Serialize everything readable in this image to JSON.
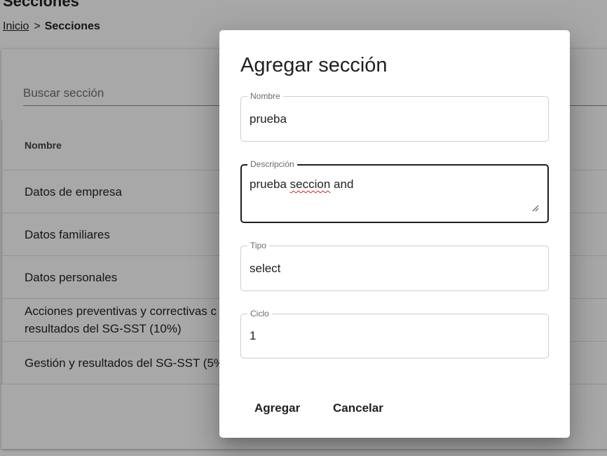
{
  "page": {
    "title": "Secciones",
    "breadcrumb": {
      "home": "Inicio",
      "separator": ">",
      "current": "Secciones"
    }
  },
  "search": {
    "placeholder": "Buscar sección",
    "value": ""
  },
  "table": {
    "header": "Nombre",
    "rows": [
      [
        "Datos de empresa"
      ],
      [
        "Datos familiares"
      ],
      [
        "Datos personales"
      ],
      [
        "Acciones preventivas y correctivas c",
        "resultados del SG-SST (10%)"
      ],
      [
        "Gestión y resultados del SG-SST (5%"
      ]
    ]
  },
  "dialog": {
    "title": "Agregar sección",
    "fields": {
      "nombre": {
        "label": "Nombre",
        "value": "prueba"
      },
      "descripcion": {
        "label": "Descripción",
        "value_prefix": "prueba ",
        "value_misspelled": "seccion",
        "value_suffix": " and"
      },
      "tipo": {
        "label": "Tipo",
        "value": "select"
      },
      "ciclo": {
        "label": "Ciclo",
        "value": "1"
      }
    },
    "buttons": {
      "add": "Agregar",
      "cancel": "Cancelar"
    }
  }
}
